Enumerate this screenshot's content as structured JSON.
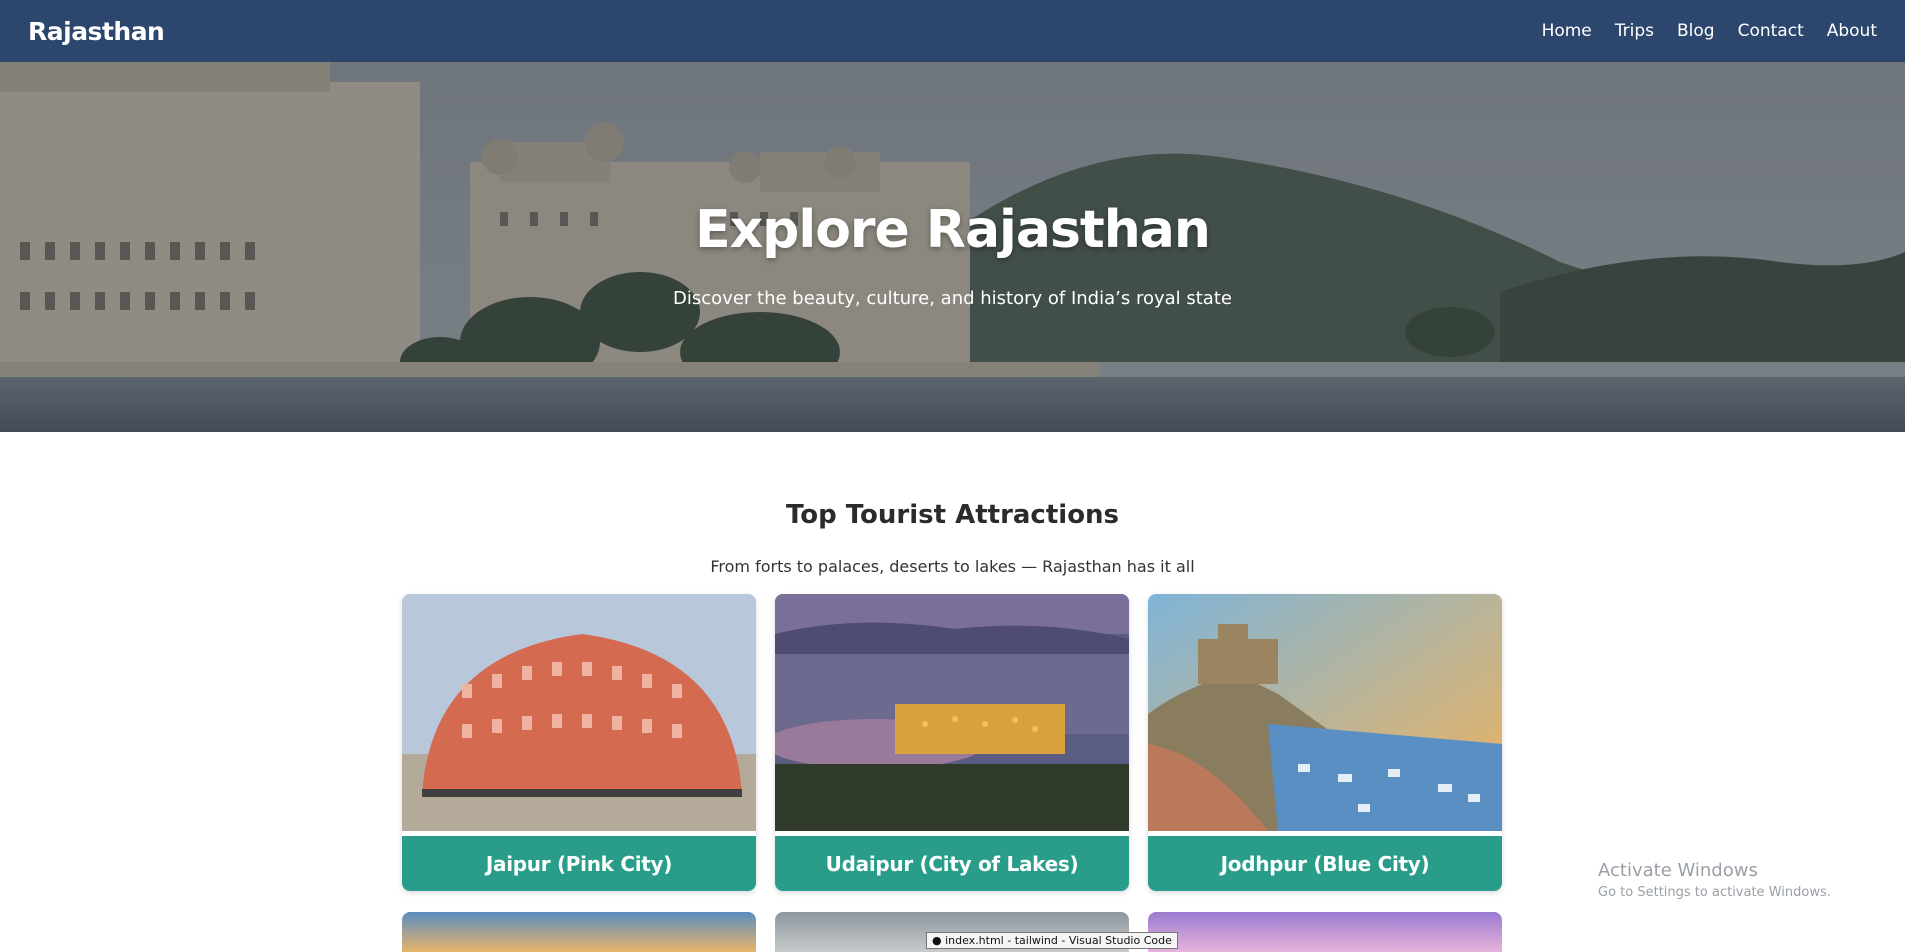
{
  "navbar": {
    "brand": "Rajasthan",
    "links": [
      "Home",
      "Trips",
      "Blog",
      "Contact",
      "About"
    ]
  },
  "hero": {
    "title": "Explore Rajasthan",
    "subtitle": "Discover the beauty, culture, and history of India’s royal state"
  },
  "attractions": {
    "title": "Top Tourist Attractions",
    "subtitle": "From forts to palaces, deserts to lakes — Rajasthan has it all",
    "cards": [
      {
        "label": "Jaipur (Pink City)"
      },
      {
        "label": "Udaipur (City of Lakes)"
      },
      {
        "label": "Jodhpur (Blue City)"
      }
    ]
  },
  "system": {
    "watermark_title": "Activate Windows",
    "watermark_sub": "Go to Settings to activate Windows.",
    "tooltip": "● index.html - tailwind - Visual Studio Code"
  },
  "colors": {
    "navbar": "#2c466d",
    "card_label": "#2a9d8a"
  }
}
